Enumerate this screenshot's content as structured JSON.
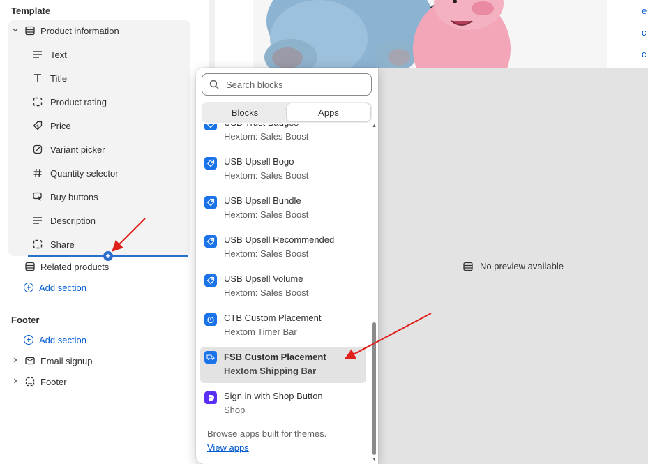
{
  "sidebar": {
    "template_label": "Template",
    "product_section": "Product information",
    "blocks": [
      {
        "label": "Text",
        "icon": "text-lines-icon"
      },
      {
        "label": "Title",
        "icon": "title-t-icon"
      },
      {
        "label": "Product rating",
        "icon": "dashed-square-icon"
      },
      {
        "label": "Price",
        "icon": "price-tag-icon"
      },
      {
        "label": "Variant picker",
        "icon": "variant-picker-icon"
      },
      {
        "label": "Quantity selector",
        "icon": "hash-icon"
      },
      {
        "label": "Buy buttons",
        "icon": "cursor-click-icon"
      },
      {
        "label": "Description",
        "icon": "text-lines-icon"
      },
      {
        "label": "Share",
        "icon": "dashed-square-icon"
      }
    ],
    "related_products": "Related products",
    "add_section": "Add section",
    "footer_label": "Footer",
    "footer_add_section": "Add section",
    "email_signup": "Email signup",
    "footer_section": "Footer"
  },
  "popover": {
    "search_placeholder": "Search blocks",
    "tabs": {
      "blocks": "Blocks",
      "apps": "Apps"
    },
    "items": [
      {
        "name": "USB Trust Badges",
        "sub": "Hextom: Sales Boost",
        "icon_color": "#1a73e8"
      },
      {
        "name": "USB Upsell Bogo",
        "sub": "Hextom: Sales Boost",
        "icon_color": "#1a73e8"
      },
      {
        "name": "USB Upsell Bundle",
        "sub": "Hextom: Sales Boost",
        "icon_color": "#1a73e8"
      },
      {
        "name": "USB Upsell Recommended",
        "sub": "Hextom: Sales Boost",
        "icon_color": "#1a73e8"
      },
      {
        "name": "USB Upsell Volume",
        "sub": "Hextom: Sales Boost",
        "icon_color": "#1a73e8"
      },
      {
        "name": "CTB Custom Placement",
        "sub": "Hextom Timer Bar",
        "icon_color": "#1a73e8"
      },
      {
        "name": "FSB Custom Placement",
        "sub": "Hextom Shipping Bar",
        "icon_color": "#1a73e8"
      },
      {
        "name": "Sign in with Shop Button",
        "sub": "Shop",
        "icon_color": "#5a31f4"
      }
    ],
    "browse_text": "Browse apps built for themes.",
    "view_apps": "View apps"
  },
  "preview": {
    "no_preview": "No preview available"
  },
  "colors": {
    "accent": "#005bd3",
    "annotation_arrow": "#e0201b"
  }
}
